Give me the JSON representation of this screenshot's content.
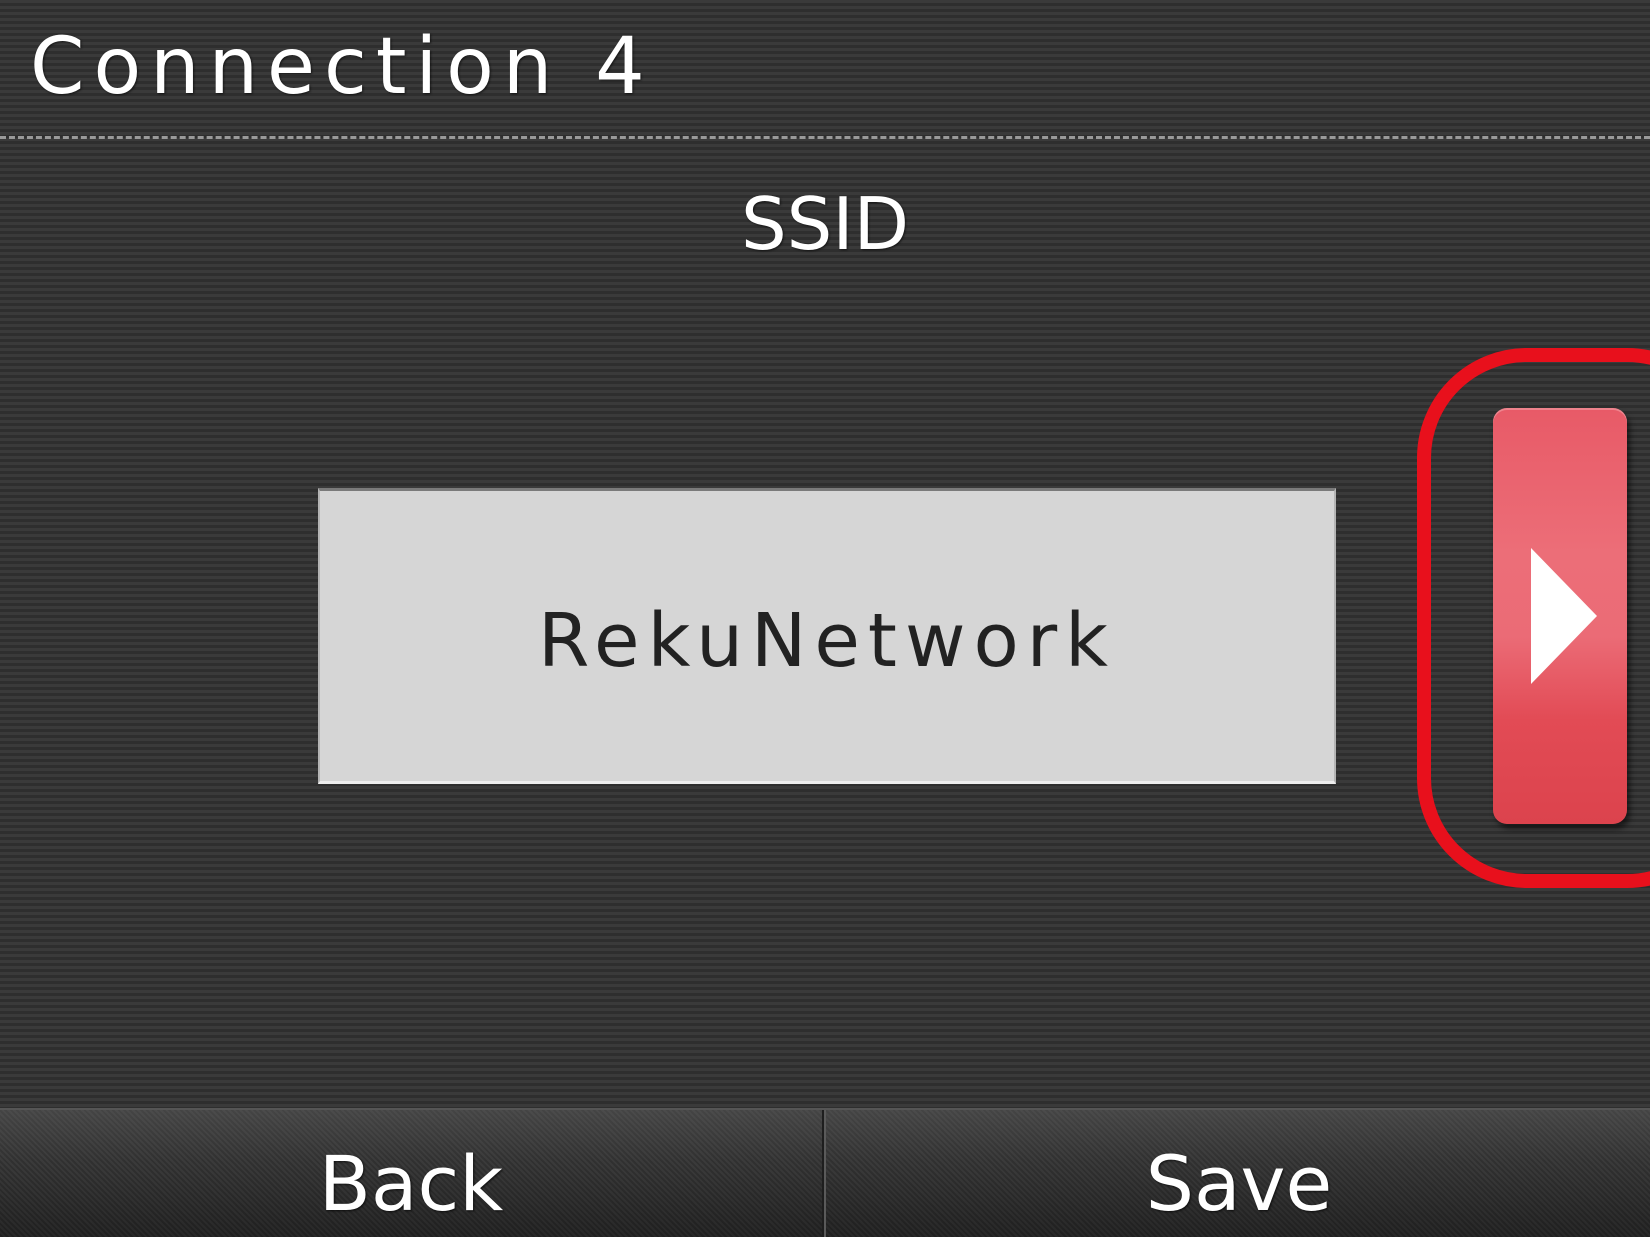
{
  "header": {
    "title": "Connection 4"
  },
  "field": {
    "label": "SSID",
    "value": "RekuNetwork"
  },
  "next_button": {
    "icon": "play-arrow-right-icon"
  },
  "softkeys": {
    "back_label": "Back",
    "save_label": "Save"
  },
  "colors": {
    "highlight": "#e8101c",
    "button_red": "#e85a67",
    "field_bg": "#d6d6d6"
  }
}
